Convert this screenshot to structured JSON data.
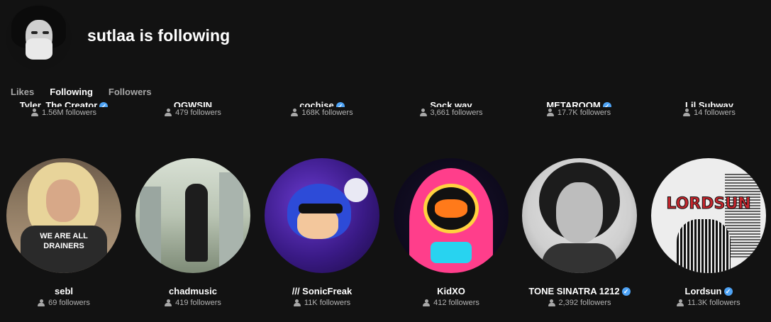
{
  "header": {
    "title": "sutlaa is following"
  },
  "tabs": [
    {
      "label": "Likes",
      "active": false
    },
    {
      "label": "Following",
      "active": true
    },
    {
      "label": "Followers",
      "active": false
    }
  ],
  "top_row": [
    {
      "name": "Tyler, The Creator",
      "verified": true,
      "followers": "1.56M followers"
    },
    {
      "name": "OGWSIN",
      "verified": false,
      "followers": "479 followers"
    },
    {
      "name": "cochise",
      "verified": true,
      "followers": "168K followers"
    },
    {
      "name": "Sock.wav",
      "verified": false,
      "followers": "3,661 followers"
    },
    {
      "name": "METAROOM",
      "verified": true,
      "followers": "17.7K followers"
    },
    {
      "name": "Lil Subway",
      "verified": false,
      "followers": "14 followers"
    }
  ],
  "grid": [
    {
      "name": "sebl",
      "verified": false,
      "followers": "69 followers",
      "shirt_text": "WE ARE ALL DRAINERS"
    },
    {
      "name": "chadmusic",
      "verified": false,
      "followers": "419 followers"
    },
    {
      "name": "/// SonicFreak",
      "verified": false,
      "followers": "11K followers"
    },
    {
      "name": "KidXO",
      "verified": false,
      "followers": "412 followers"
    },
    {
      "name": "TONE SINATRA 1212",
      "verified": true,
      "followers": "2,392 followers"
    },
    {
      "name": "Lordsun",
      "verified": true,
      "followers": "11.3K followers",
      "logo_text": "LORDSUN"
    }
  ],
  "colors": {
    "background": "#121212",
    "text_primary": "#ffffff",
    "text_secondary": "#b3b3b3",
    "verified": "#4ea3f5"
  },
  "icons": {
    "followers": "person-icon",
    "verified": "verified-badge-icon"
  }
}
